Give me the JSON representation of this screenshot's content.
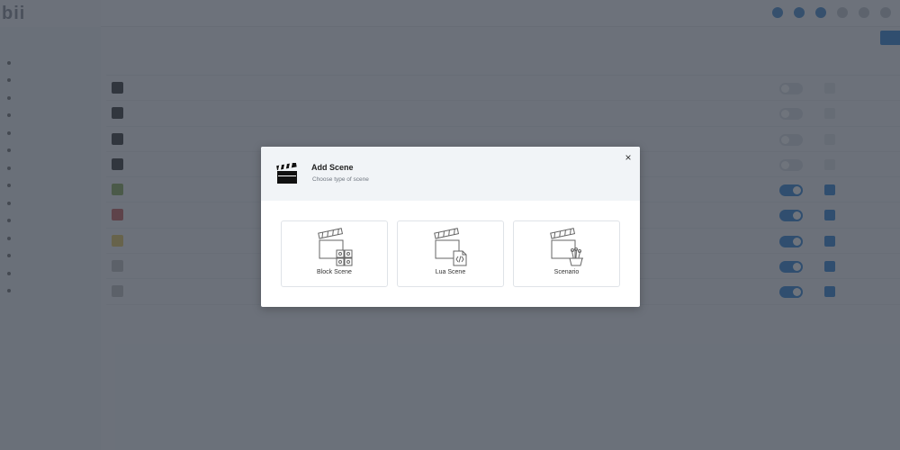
{
  "dialog": {
    "title": "Add Scene",
    "subtitle": "Choose type of scene",
    "close_label": "×",
    "options": [
      {
        "label": "Block Scene",
        "icon": "block-scene-icon"
      },
      {
        "label": "Lua Scene",
        "icon": "lua-scene-icon"
      },
      {
        "label": "Scenario",
        "icon": "scenario-icon"
      }
    ]
  },
  "background": {
    "brand_color": "#1d78d0",
    "overlay_color": "#373e4a"
  }
}
